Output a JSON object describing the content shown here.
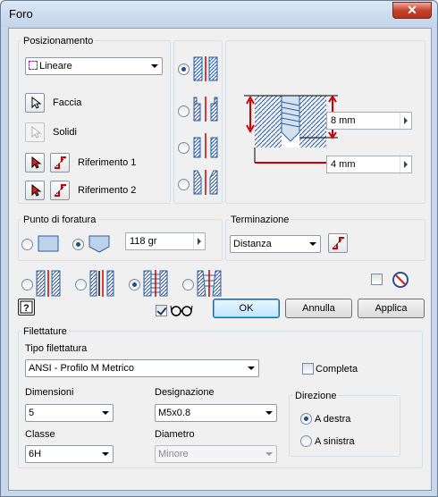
{
  "window": {
    "title": "Foro",
    "close": "✕"
  },
  "positioning": {
    "group_label": "Posizionamento",
    "placement": "Lineare",
    "face_label": "Faccia",
    "solids_label": "Solidi",
    "ref1_label": "Riferimento 1",
    "ref2_label": "Riferimento 2"
  },
  "preview": {
    "depth_value": "8 mm",
    "diameter_value": "4 mm"
  },
  "drill_point": {
    "group_label": "Punto di foratura",
    "angle_value": "118 gr"
  },
  "termination": {
    "group_label": "Terminazione",
    "value": "Distanza"
  },
  "buttons": {
    "ok": "OK",
    "cancel": "Annulla",
    "apply": "Applica"
  },
  "threads": {
    "group_label": "Filettature",
    "type_label": "Tipo filettatura",
    "type_value": "ANSI - Profilo M Metrico",
    "complete_label": "Completa",
    "size_label": "Dimensioni",
    "size_value": "5",
    "designation_label": "Designazione",
    "designation_value": "M5x0.8",
    "class_label": "Classe",
    "class_value": "6H",
    "diameter_label": "Diametro",
    "diameter_value": "Minore",
    "direction": {
      "group_label": "Direzione",
      "right": "A destra",
      "left": "A sinistra"
    }
  },
  "colors": {
    "accent": "#cc0000",
    "hatch": "#2b5fa6"
  }
}
